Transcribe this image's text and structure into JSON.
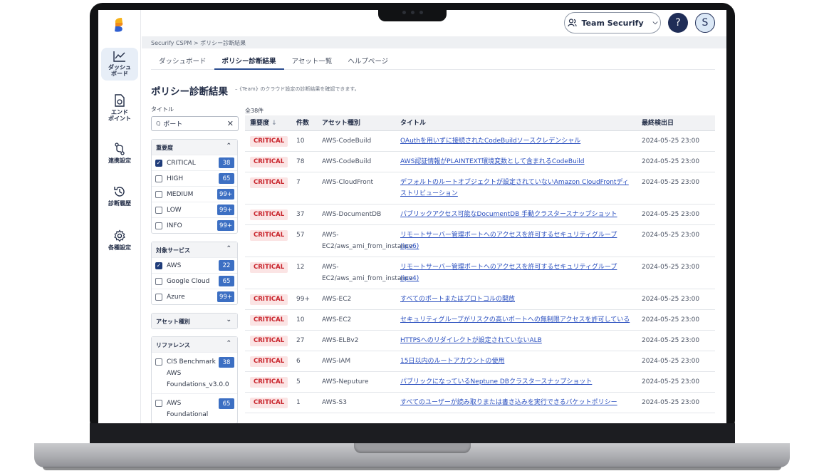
{
  "header": {
    "team_label": "Team Securify",
    "help_label": "?",
    "avatar_initial": "S"
  },
  "sidebar": {
    "items": [
      {
        "label": "ダッシュ\nボード",
        "icon": "chart-line-icon",
        "active": true
      },
      {
        "label": "エンド\nポイント",
        "icon": "endpoint-file-icon",
        "active": false
      },
      {
        "label": "連携設定",
        "icon": "git-branch-icon",
        "active": false
      },
      {
        "label": "診断履歴",
        "icon": "history-icon",
        "active": false
      },
      {
        "label": "各種設定",
        "icon": "gear-icon",
        "active": false
      }
    ]
  },
  "breadcrumb": "Securify CSPM > ポリシー診断結果",
  "tabs": [
    {
      "label": "ダッシュボード",
      "active": false
    },
    {
      "label": "ポリシー診断結果",
      "active": true
    },
    {
      "label": "アセット一覧",
      "active": false
    },
    {
      "label": "ヘルプページ",
      "active": false
    }
  ],
  "page": {
    "title": "ポリシー診断結果",
    "subtitle": "– {Team} のクラウド設定の診断結果を確認できます。"
  },
  "filters": {
    "title_label": "タイトル",
    "search_value": "ポート",
    "search_prefix": "Q",
    "severity": {
      "label": "重要度",
      "options": [
        {
          "label": "CRITICAL",
          "count": "38",
          "checked": true
        },
        {
          "label": "HIGH",
          "count": "65",
          "checked": false
        },
        {
          "label": "MEDIUM",
          "count": "99+",
          "checked": false
        },
        {
          "label": "LOW",
          "count": "99+",
          "checked": false
        },
        {
          "label": "INFO",
          "count": "99+",
          "checked": false
        }
      ]
    },
    "service": {
      "label": "対象サービス",
      "options": [
        {
          "label": "AWS",
          "count": "22",
          "checked": true
        },
        {
          "label": "Google Cloud",
          "count": "65",
          "checked": false
        },
        {
          "label": "Azure",
          "count": "99+",
          "checked": false
        }
      ]
    },
    "asset_type": {
      "label": "アセット種別"
    },
    "reference": {
      "label": "リファレンス",
      "options": [
        {
          "label": "CIS Benchmark AWS Foundations_v3.0.0",
          "count": "38",
          "checked": false
        },
        {
          "label": "AWS Foundational",
          "count": "65",
          "checked": false
        }
      ]
    }
  },
  "table": {
    "total_label": "全38件",
    "columns": [
      "重要度",
      "件数",
      "アセット種別",
      "タイトル",
      "最終検出日"
    ],
    "rows": [
      {
        "severity": "CRITICAL",
        "count": "10",
        "asset": "AWS-CodeBuild",
        "title": "OAuthを用いずに接続されたCodeBuildソースクレデンシャル",
        "date": "2024-05-25 23:00"
      },
      {
        "severity": "CRITICAL",
        "count": "78",
        "asset": "AWS-CodeBuild",
        "title": "AWS認証情報がPLAINTEXT環境変数として含まれるCodeBuild",
        "date": "2024-05-25 23:00"
      },
      {
        "severity": "CRITICAL",
        "count": "7",
        "asset": "AWS-CloudFront",
        "title": "デフォルトのルートオブジェクトが設定されていないAmazon CloudFrontディストリビューション",
        "date": "2024-05-25 23:00"
      },
      {
        "severity": "CRITICAL",
        "count": "37",
        "asset": "AWS-DocumentDB",
        "title": "パブリックアクセス可能なDocumentDB 手動クラスタースナップショット",
        "date": "2024-05-25 23:00"
      },
      {
        "severity": "CRITICAL",
        "count": "57",
        "asset": "AWS-EC2/aws_ami_from_instance",
        "title": "リモートサーバー管理ポートへのアクセスを許可するセキュリティグループ(ipv6)",
        "date": "2024-05-25 23:00"
      },
      {
        "severity": "CRITICAL",
        "count": "12",
        "asset": "AWS-EC2/aws_ami_from_instance",
        "title": "リモートサーバー管理ポートへのアクセスを許可するセキュリティグループ(ipv4)",
        "date": "2024-05-25 23:00"
      },
      {
        "severity": "CRITICAL",
        "count": "99+",
        "asset": "AWS-EC2",
        "title": "すべてのポートまたはプロトコルの開放",
        "date": "2024-05-25 23:00"
      },
      {
        "severity": "CRITICAL",
        "count": "10",
        "asset": "AWS-EC2",
        "title": "セキュリティグループがリスクの高いポートへの無制限アクセスを許可している",
        "date": "2024-05-25 23:00"
      },
      {
        "severity": "CRITICAL",
        "count": "27",
        "asset": "AWS-ELBv2",
        "title": "HTTPSへのリダイレクトが設定されていないALB",
        "date": "2024-05-25 23:00"
      },
      {
        "severity": "CRITICAL",
        "count": "6",
        "asset": "AWS-IAM",
        "title": "15日以内のルートアカウントの使用",
        "date": "2024-05-25 23:00"
      },
      {
        "severity": "CRITICAL",
        "count": "5",
        "asset": "AWS-Neputure",
        "title": "パブリックになっているNeptune DBクラスタースナップショット",
        "date": "2024-05-25 23:00"
      },
      {
        "severity": "CRITICAL",
        "count": "1",
        "asset": "AWS-S3",
        "title": "すべてのユーザーが読み取りまたは書き込みを実行できるバケットポリシー",
        "date": "2024-05-25 23:00"
      }
    ]
  }
}
